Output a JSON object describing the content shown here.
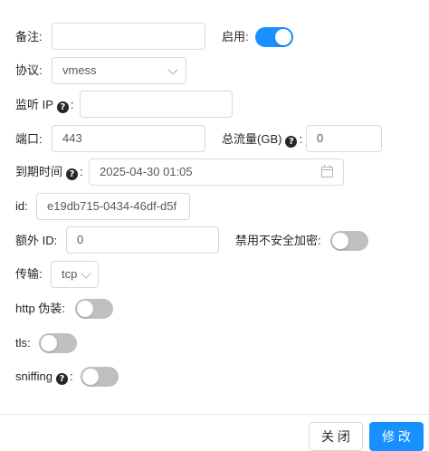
{
  "fields": {
    "remark": {
      "label": "备注",
      "value": ""
    },
    "enable": {
      "label": "启用",
      "on": true
    },
    "protocol": {
      "label": "协议",
      "value": "vmess"
    },
    "listen": {
      "label": "监听 IP",
      "value": ""
    },
    "port": {
      "label": "端口",
      "value": "443"
    },
    "total": {
      "label": "总流量(GB)",
      "value": "0"
    },
    "expiry": {
      "label": "到期时间",
      "value": "2025-04-30 01:05"
    },
    "id": {
      "label": "id",
      "value": "e19db715-0434-46df-d5f"
    },
    "alter_id": {
      "label": "额外 ID",
      "value": "0"
    },
    "disable_insecure": {
      "label": "禁用不安全加密",
      "on": false
    },
    "network": {
      "label": "传输",
      "value": "tcp"
    },
    "http_obfs": {
      "label": "http 伪装",
      "on": false
    },
    "tls": {
      "label": "tls",
      "on": false
    },
    "sniffing": {
      "label": "sniffing",
      "on": false
    }
  },
  "colon": ":",
  "help_glyph": "?",
  "footer": {
    "close_label": "关 闭",
    "modify_label": "修 改"
  },
  "colors": {
    "accent": "#1890ff",
    "switch_off": "#bfbfbf",
    "border": "#d9d9d9"
  }
}
